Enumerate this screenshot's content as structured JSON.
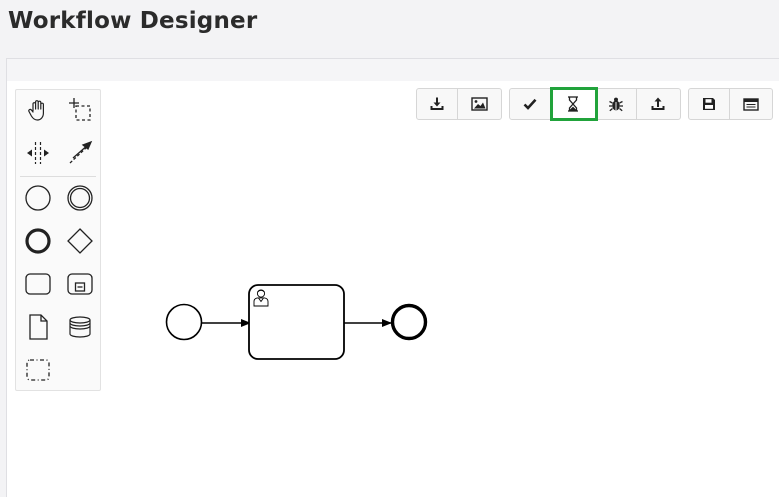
{
  "header": {
    "title": "Workflow Designer"
  },
  "colors": {
    "accent_green": "#21a33b",
    "stroke": "#1a1a1a",
    "panel_bg": "#ffffff",
    "page_bg": "#f3f3f5"
  },
  "palette": {
    "tools": [
      {
        "icon": "hand-tool-icon"
      },
      {
        "icon": "lasso-tool-icon"
      },
      {
        "icon": "space-tool-icon"
      },
      {
        "icon": "global-connect-tool-icon"
      },
      {
        "icon": "start-event-icon"
      },
      {
        "icon": "intermediate-event-icon"
      },
      {
        "icon": "end-event-icon"
      },
      {
        "icon": "gateway-icon"
      },
      {
        "icon": "task-icon"
      },
      {
        "icon": "subprocess-icon"
      },
      {
        "icon": "data-object-icon"
      },
      {
        "icon": "data-store-icon"
      },
      {
        "icon": "group-icon"
      }
    ]
  },
  "toolbar": {
    "groups": [
      [
        {
          "icon": "download-icon"
        },
        {
          "icon": "image-icon"
        }
      ],
      [
        {
          "icon": "check-icon"
        },
        {
          "icon": "hourglass-icon",
          "active": true
        },
        {
          "icon": "bug-icon"
        },
        {
          "icon": "upload-icon"
        }
      ],
      [
        {
          "icon": "save-icon"
        },
        {
          "icon": "window-icon"
        }
      ]
    ]
  },
  "diagram": {
    "elements": [
      "start-event",
      "user-task",
      "end-event"
    ],
    "task_type": "user-task-icon"
  }
}
